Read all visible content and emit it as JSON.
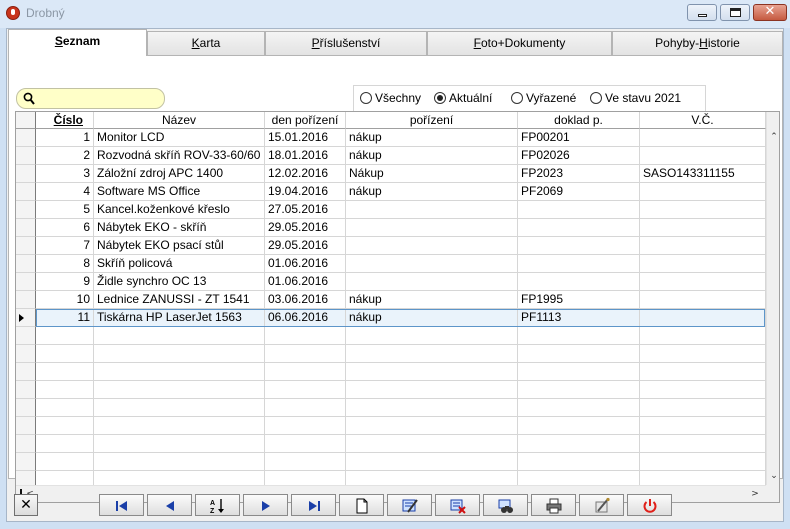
{
  "window": {
    "title": "Drobný"
  },
  "tabs": [
    {
      "pre": "",
      "acc": "S",
      "post": "eznam",
      "active": true
    },
    {
      "pre": "",
      "acc": "K",
      "post": "arta",
      "active": false
    },
    {
      "pre": "",
      "acc": "P",
      "post": "říslušenství",
      "active": false
    },
    {
      "pre": "",
      "acc": "F",
      "post": "oto+Dokumenty",
      "active": false
    },
    {
      "pre": "Pohyby-",
      "acc": "H",
      "post": "istorie",
      "active": false
    }
  ],
  "search": {
    "value": "",
    "placeholder": ""
  },
  "filter": {
    "options": [
      {
        "label": "Všechny",
        "checked": false
      },
      {
        "label": "Aktuální",
        "checked": true
      },
      {
        "label": "Vyřazené",
        "checked": false
      },
      {
        "label": "Ve stavu 2021",
        "checked": false
      }
    ]
  },
  "grid": {
    "columns": [
      "Číslo",
      "Název",
      "den pořízení",
      "pořízení",
      "doklad p.",
      "V.Č."
    ],
    "rows": [
      {
        "cislo": "1",
        "nazev": "Monitor  LCD",
        "den": "15.01.2016",
        "porizeni": "nákup",
        "doklad": "FP00201",
        "vc": ""
      },
      {
        "cislo": "2",
        "nazev": "Rozvodná skříň ROV-33-60/60",
        "den": "18.01.2016",
        "porizeni": "nákup",
        "doklad": "FP02026",
        "vc": ""
      },
      {
        "cislo": "3",
        "nazev": "Záložní zdroj APC 1400",
        "den": "12.02.2016",
        "porizeni": "Nákup",
        "doklad": "FP2023",
        "vc": "SASO143311155"
      },
      {
        "cislo": "4",
        "nazev": "Software MS Office",
        "den": "19.04.2016",
        "porizeni": "nákup",
        "doklad": " PF2069",
        "vc": ""
      },
      {
        "cislo": "5",
        "nazev": "Kancel.koženkové křeslo",
        "den": "27.05.2016",
        "porizeni": "",
        "doklad": "",
        "vc": ""
      },
      {
        "cislo": "6",
        "nazev": "Nábytek EKO - skříň",
        "den": "29.05.2016",
        "porizeni": "",
        "doklad": "",
        "vc": ""
      },
      {
        "cislo": "7",
        "nazev": "Nábytek EKO psací stůl",
        "den": "29.05.2016",
        "porizeni": "",
        "doklad": "",
        "vc": ""
      },
      {
        "cislo": "8",
        "nazev": "Skříň policová",
        "den": "01.06.2016",
        "porizeni": "",
        "doklad": "",
        "vc": ""
      },
      {
        "cislo": "9",
        "nazev": "Židle synchro OC 13",
        "den": "01.06.2016",
        "porizeni": "",
        "doklad": "",
        "vc": ""
      },
      {
        "cislo": "10",
        "nazev": "Lednice ZANUSSI - ZT 1541",
        "den": "03.06.2016",
        "porizeni": "nákup",
        "doklad": "FP1995",
        "vc": ""
      },
      {
        "cislo": "11",
        "nazev": "Tiskárna HP LaserJet 1563",
        "den": "06.06.2016",
        "porizeni": "nákup",
        "doklad": "PF1113",
        "vc": ""
      }
    ],
    "selected_index": 10,
    "empty_rows": 9
  },
  "toolbar": {
    "buttons": [
      {
        "name": "first-record-button",
        "icon": "first-record-icon"
      },
      {
        "name": "previous-record-button",
        "icon": "previous-record-icon"
      },
      {
        "name": "sort-button",
        "icon": "sort-az-icon"
      },
      {
        "name": "next-record-button",
        "icon": "next-record-icon"
      },
      {
        "name": "last-record-button",
        "icon": "last-record-icon"
      },
      {
        "name": "new-record-button",
        "icon": "new-document-icon"
      },
      {
        "name": "edit-record-button",
        "icon": "edit-record-icon"
      },
      {
        "name": "delete-record-button",
        "icon": "delete-record-icon"
      },
      {
        "name": "find-record-button",
        "icon": "binoculars-icon"
      },
      {
        "name": "print-button",
        "icon": "printer-icon"
      },
      {
        "name": "tools-button",
        "icon": "tools-icon"
      },
      {
        "name": "exit-button",
        "icon": "power-icon"
      }
    ]
  }
}
